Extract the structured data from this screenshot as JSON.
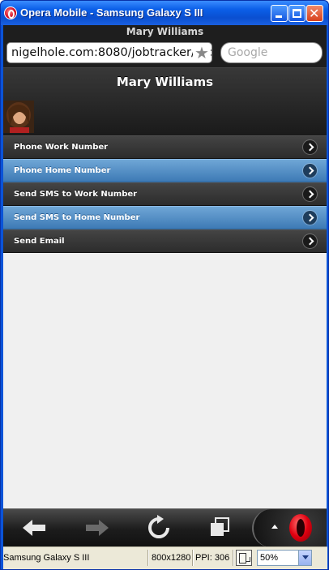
{
  "window": {
    "title": "Opera Mobile - Samsung Galaxy S III"
  },
  "browser": {
    "page_title": "Mary Williams",
    "url": "nigelhole.com:8080/jobtracker/secu",
    "search_placeholder": "Google"
  },
  "page": {
    "header_title": "Mary Williams",
    "actions": [
      {
        "label": "Phone Work Number",
        "highlighted": false
      },
      {
        "label": "Phone Home Number",
        "highlighted": true
      },
      {
        "label": "Send SMS to Work Number",
        "highlighted": false
      },
      {
        "label": "Send SMS to Home Number",
        "highlighted": true
      },
      {
        "label": "Send Email",
        "highlighted": false
      }
    ]
  },
  "toolbar": {
    "icons": [
      "back-icon",
      "forward-icon",
      "reload-icon",
      "tabs-icon",
      "opera-menu-icon"
    ]
  },
  "statusbar": {
    "device": "Samsung Galaxy S III",
    "resolution": "800x1280",
    "ppi": "PPI: 306",
    "zoom": "50%"
  },
  "colors": {
    "titlebar": "#0b5fe8",
    "row_dark": "#2c2c2c",
    "row_blue": "#3d7ab5"
  }
}
